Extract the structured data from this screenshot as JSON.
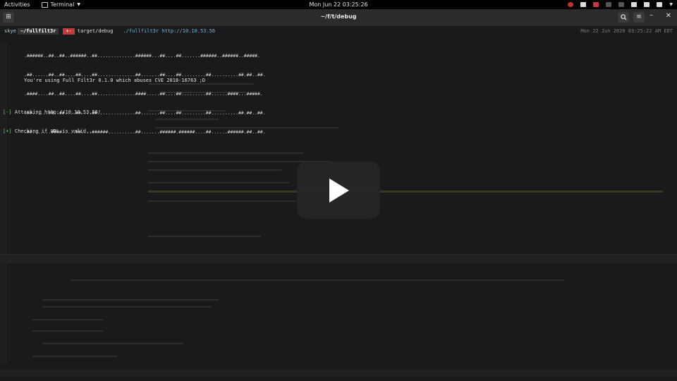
{
  "topbar": {
    "activities": "Activities",
    "app_name": "Terminal",
    "clock": "Mon Jun 22  03:25:26"
  },
  "window": {
    "title": "~/f/t/debug",
    "search_icon": "search-icon",
    "menu_icon": "hamburger-menu-icon"
  },
  "prompt": {
    "user": "skye",
    "path": "~/fullfilt3r",
    "git": "+-",
    "branch": "target/debug",
    "command": "./fullfilt3r http://10.10.53.56",
    "right_time": "Mon 22 Jun 2020 03:25:22 AM EDT"
  },
  "banner": {
    "lines": [
      ".######..##..##..######..##..............######...##....##.......######..######..#####.",
      ".##......##..##....##....##..............##.......##....##.........##..........##.##..##.",
      ".####....##..##....##....##..............####.....##....##.........##......####...#####.",
      ".##......##..##....##....##..............##.......##....##.........##..........##.##..##.",
      ".##.......####.....##....######..........##.......######.######....##......######.##..##."
    ]
  },
  "using_line": "You're using Full Filt3r 0.1.0 which abuses CVE 2018-16763 ;D",
  "log": [
    {
      "tag": "[-]",
      "text": " Attacking http://10.10.53.56!"
    },
    {
      "tag": "[+]",
      "text": " Checking if URL is valid..."
    }
  ],
  "overlay": {
    "play_icon": "play-icon"
  }
}
